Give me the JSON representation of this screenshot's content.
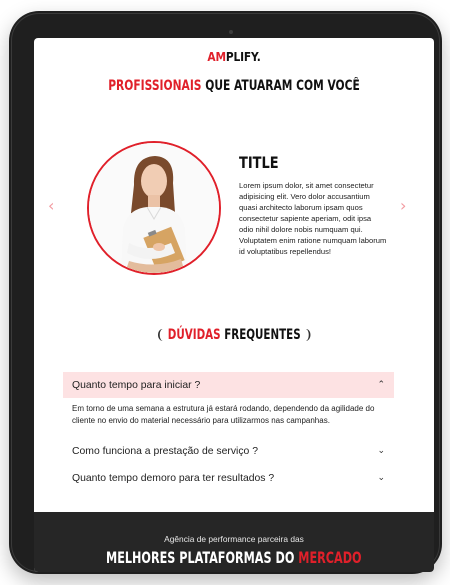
{
  "brand": {
    "logo_accent": "AM",
    "logo_rest": "PLIFY."
  },
  "headline": {
    "red": "PROFISSIONAIS",
    "black": " QUE ATUARAM COM VOCÊ"
  },
  "carousel": {
    "prev_icon": "chevron-left-icon",
    "next_icon": "chevron-right-icon",
    "card": {
      "title": "TITLE",
      "text": "Lorem ipsum dolor, sit amet consectetur adipisicing elit. Vero dolor accusantium quasi architecto laborum ipsam quos consectetur sapiente aperiam, odit ipsa odio nihil dolore nobis numquam qui. Voluptatem enim ratione numquam laborum id voluptatibus repellendus!"
    }
  },
  "faq": {
    "title_red": "DÚVIDAS",
    "title_black": " FREQUENTES",
    "items": [
      {
        "question": "Quanto tempo para iniciar ?",
        "open": true,
        "answer": "Em torno de uma semana a estrutura já estará rodando, dependendo da agilidade do cliente no envio do material necessário para utilizarmos nas campanhas."
      },
      {
        "question": "Como funciona a prestação de serviço ?",
        "open": false
      },
      {
        "question": "Quanto tempo demoro para ter resultados ?",
        "open": false
      }
    ]
  },
  "footer": {
    "subtitle": "Agência de performance parceira das",
    "title_white": "MELHORES PLATAFORMAS DO ",
    "title_red": "MERCADO"
  },
  "colors": {
    "accent": "#e0202a",
    "faq_open_bg": "#fde2e3",
    "footer_bg": "#262626"
  }
}
